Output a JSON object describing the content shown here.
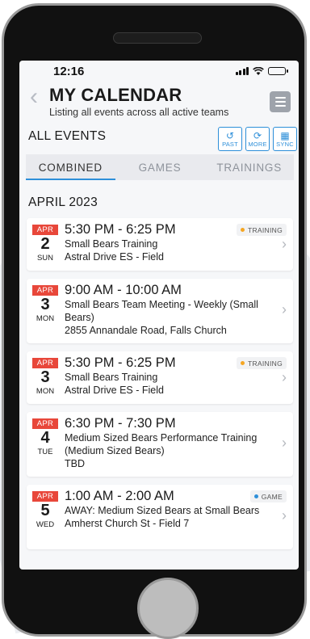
{
  "status": {
    "time": "12:16"
  },
  "header": {
    "title": "MY CALENDAR",
    "subtitle": "Listing all events across all active teams",
    "back_icon": "chevron-left-icon",
    "menu_icon": "hamburger-menu-icon"
  },
  "events_header": {
    "label": "ALL EVENTS",
    "buttons": [
      {
        "label": "PAST",
        "icon": "history-icon"
      },
      {
        "label": "MORE",
        "icon": "refresh-icon"
      },
      {
        "label": "SYNC",
        "icon": "calendar-sync-icon"
      }
    ]
  },
  "tabs": [
    {
      "label": "COMBINED",
      "active": true
    },
    {
      "label": "GAMES",
      "active": false
    },
    {
      "label": "TRAININGS",
      "active": false
    }
  ],
  "month_heading": "APRIL 2023",
  "colors": {
    "accent": "#2d8fd9",
    "date_badge": "#e8473a",
    "training_dot": "#f5a623",
    "game_dot": "#2d8fd9"
  },
  "events": [
    {
      "month": "APR",
      "day": "2",
      "weekday": "SUN",
      "time": "5:30 PM - 6:25 PM",
      "name": "Small Bears Training",
      "location": "Astral Drive ES - Field",
      "badge": "TRAINING"
    },
    {
      "month": "APR",
      "day": "3",
      "weekday": "MON",
      "time": "9:00 AM - 10:00 AM",
      "name": "Small Bears Team Meeting - Weekly (Small Bears)",
      "location": "2855 Annandale Road, Falls Church",
      "badge": ""
    },
    {
      "month": "APR",
      "day": "3",
      "weekday": "MON",
      "time": "5:30 PM - 6:25 PM",
      "name": "Small Bears Training",
      "location": "Astral Drive ES - Field",
      "badge": "TRAINING"
    },
    {
      "month": "APR",
      "day": "4",
      "weekday": "TUE",
      "time": "6:30 PM - 7:30 PM",
      "name": "Medium Sized Bears Performance Training (Medium Sized Bears)",
      "location": "TBD",
      "badge": ""
    },
    {
      "month": "APR",
      "day": "5",
      "weekday": "WED",
      "time": "1:00 AM - 2:00 AM",
      "name": "AWAY: Medium Sized Bears at Small Bears",
      "location": "Amherst Church St - Field 7",
      "badge": "GAME"
    }
  ]
}
